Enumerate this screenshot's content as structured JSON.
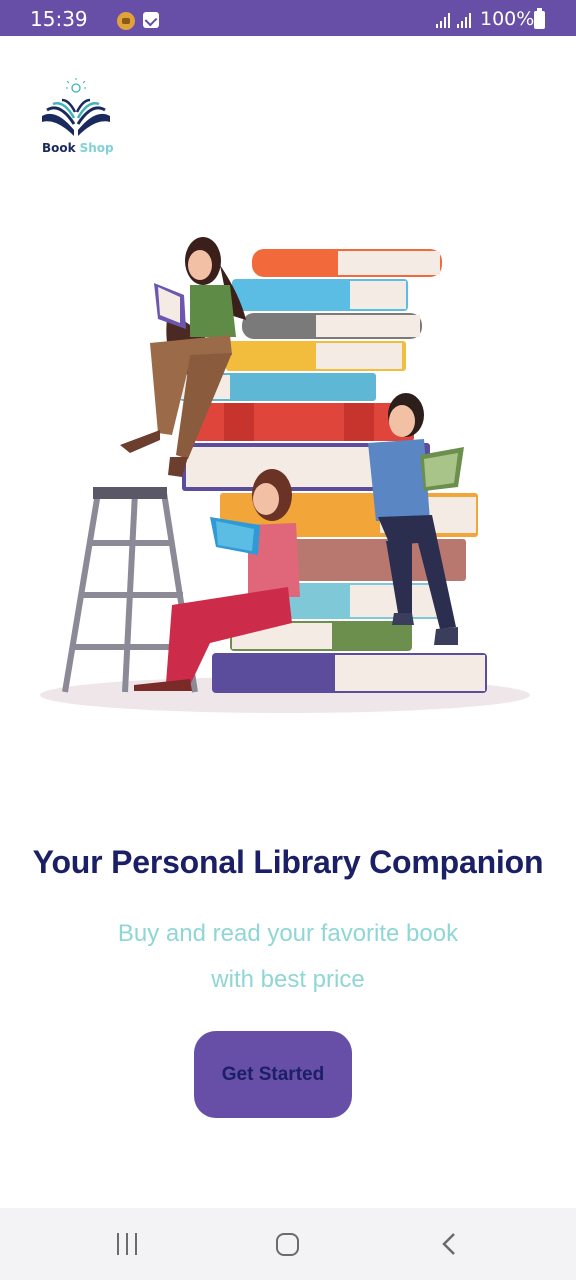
{
  "status_bar": {
    "time": "15:39",
    "battery": "100%",
    "background": "#674ea7"
  },
  "logo": {
    "word1": "Book",
    "word2": "Shop",
    "icon": "open-book-bulb-icon"
  },
  "onboarding": {
    "headline": "Your Personal Library Companion",
    "subtitle_line1": "Buy and read your favorite book",
    "subtitle_line2": "with best price",
    "cta_label": "Get Started"
  },
  "colors": {
    "accent": "#674ea7",
    "headline": "#1b1f66",
    "subtitle": "#8fd6d6"
  },
  "nav_bar": {
    "recent_icon": "recent-apps-icon",
    "home_icon": "home-icon",
    "back_icon": "back-icon"
  }
}
